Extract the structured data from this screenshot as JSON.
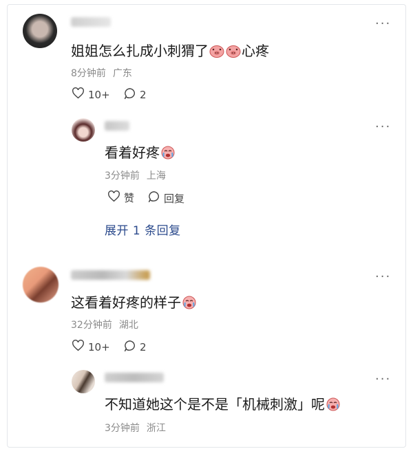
{
  "comments": [
    {
      "text": "姐姐怎么扎成小刺猬了",
      "text_suffix": "心疼",
      "time": "8分钟前",
      "location": "广东",
      "like_count": "10+",
      "reply_count": "2",
      "replies": [
        {
          "text": "看着好疼",
          "time": "3分钟前",
          "location": "上海",
          "like_label": "赞",
          "reply_label": "回复"
        }
      ],
      "expand_label": "展开 1 条回复"
    },
    {
      "text": "这看着好疼的样子",
      "time": "32分钟前",
      "location": "湖北",
      "like_count": "10+",
      "reply_count": "2",
      "replies": [
        {
          "text": "不知道她这个是不是「机械刺激」呢",
          "time": "3分钟前",
          "location": "浙江"
        }
      ]
    }
  ],
  "colors": {
    "accent_link": "#2b4a8c",
    "meta_gray": "#8a8a8a",
    "border": "#e3e6ea"
  },
  "icons": [
    "more-icon",
    "heart-icon",
    "comment-bubble-icon",
    "crying-emoji-icon",
    "pig-face-emoji-icon"
  ]
}
